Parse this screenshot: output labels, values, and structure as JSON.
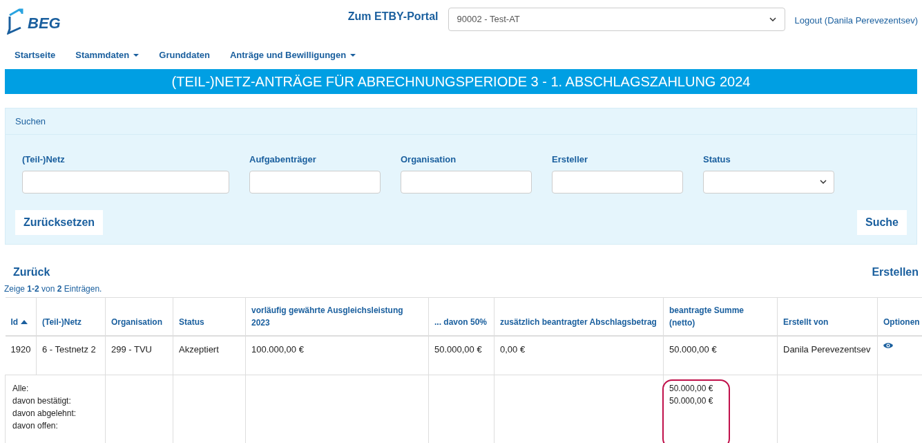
{
  "header": {
    "logo_text": "BEG",
    "portal_link": "Zum ETBY-Portal",
    "org_select": {
      "value": "90002 - Test-AT"
    },
    "logout_link": "Logout (Danila Perevezentsev)"
  },
  "nav": [
    {
      "label": "Startseite",
      "dropdown": false
    },
    {
      "label": "Stammdaten",
      "dropdown": true
    },
    {
      "label": "Grunddaten",
      "dropdown": false
    },
    {
      "label": "Anträge und Bewilligungen",
      "dropdown": true
    }
  ],
  "page_title": "(TEIL-)NETZ-ANTRÄGE FÜR ABRECHNUNGSPERIODE 3 - 1. ABSCHLAGSZAHLUNG 2024",
  "search": {
    "title": "Suchen",
    "fields": [
      {
        "label": "(Teil-)Netz",
        "kind": "text"
      },
      {
        "label": "Aufgabenträger",
        "kind": "text"
      },
      {
        "label": "Organisation",
        "kind": "text"
      },
      {
        "label": "Ersteller",
        "kind": "text"
      },
      {
        "label": "Status",
        "kind": "select"
      }
    ],
    "reset_button": "Zurücksetzen",
    "search_button": "Suche"
  },
  "back_link": "Zurück",
  "create_link": "Erstellen",
  "summary_text": "Zeige **1-2** von **2** Einträgen.",
  "table": {
    "columns": [
      {
        "label": "Id",
        "sorted": true
      },
      {
        "label": "(Teil-)Netz",
        "sorted": false
      },
      {
        "label": "Organisation",
        "sorted": false
      },
      {
        "label": "Status",
        "sorted": false
      },
      {
        "label": "vorläufig gewährte Ausgleichsleistung 2023",
        "sorted": false
      },
      {
        "label": "... davon 50%",
        "sorted": false
      },
      {
        "label": "zusätzlich beantragter Abschlagsbetrag",
        "sorted": false
      },
      {
        "label": "beantragte Summe (netto)",
        "sorted": false
      },
      {
        "label": "Erstellt von",
        "sorted": false
      },
      {
        "label": "Optionen",
        "sorted": false
      }
    ],
    "rows": [
      {
        "cells": [
          "1920",
          "6 - Testnetz 2",
          "299 - TVU",
          "Akzeptiert",
          "100.000,00 €",
          "50.000,00 €",
          "0,00 €",
          "50.000,00 €",
          "Danila Perevezentsev"
        ]
      }
    ],
    "totals": {
      "labels": [
        "Alle:",
        "davon bestätigt:",
        "davon abgelehnt:",
        "davon offen:"
      ],
      "sum_values": [
        "50.000,00 €",
        "50.000,00 €"
      ],
      "highlighted": true
    }
  }
}
